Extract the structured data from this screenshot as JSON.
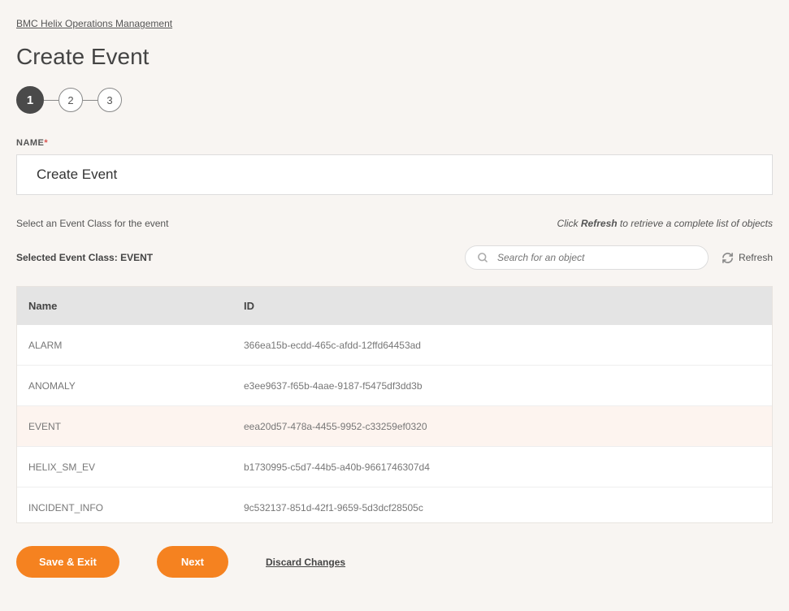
{
  "breadcrumb": "BMC Helix Operations Management",
  "page_title": "Create Event",
  "steps": [
    "1",
    "2",
    "3"
  ],
  "active_step": 0,
  "name_field": {
    "label": "NAME",
    "required": "*",
    "value": "Create Event"
  },
  "hint_left": "Select an Event Class for the event",
  "hint_right_prefix": "Click ",
  "hint_right_strong": "Refresh",
  "hint_right_suffix": " to retrieve a complete list of objects",
  "selected_class_label": "Selected Event Class: ",
  "selected_class_value": "EVENT",
  "search_placeholder": "Search for an object",
  "refresh_label": "Refresh",
  "table": {
    "headers": {
      "name": "Name",
      "id": "ID"
    },
    "rows": [
      {
        "name": "ALARM",
        "id": "366ea15b-ecdd-465c-afdd-12ffd64453ad",
        "selected": false
      },
      {
        "name": "ANOMALY",
        "id": "e3ee9637-f65b-4aae-9187-f5475df3dd3b",
        "selected": false
      },
      {
        "name": "EVENT",
        "id": "eea20d57-478a-4455-9952-c33259ef0320",
        "selected": true
      },
      {
        "name": "HELIX_SM_EV",
        "id": "b1730995-c5d7-44b5-a40b-9661746307d4",
        "selected": false
      },
      {
        "name": "INCIDENT_INFO",
        "id": "9c532137-851d-42f1-9659-5d3dcf28505c",
        "selected": false
      }
    ]
  },
  "footer": {
    "save_exit": "Save & Exit",
    "next": "Next",
    "discard": "Discard Changes"
  }
}
